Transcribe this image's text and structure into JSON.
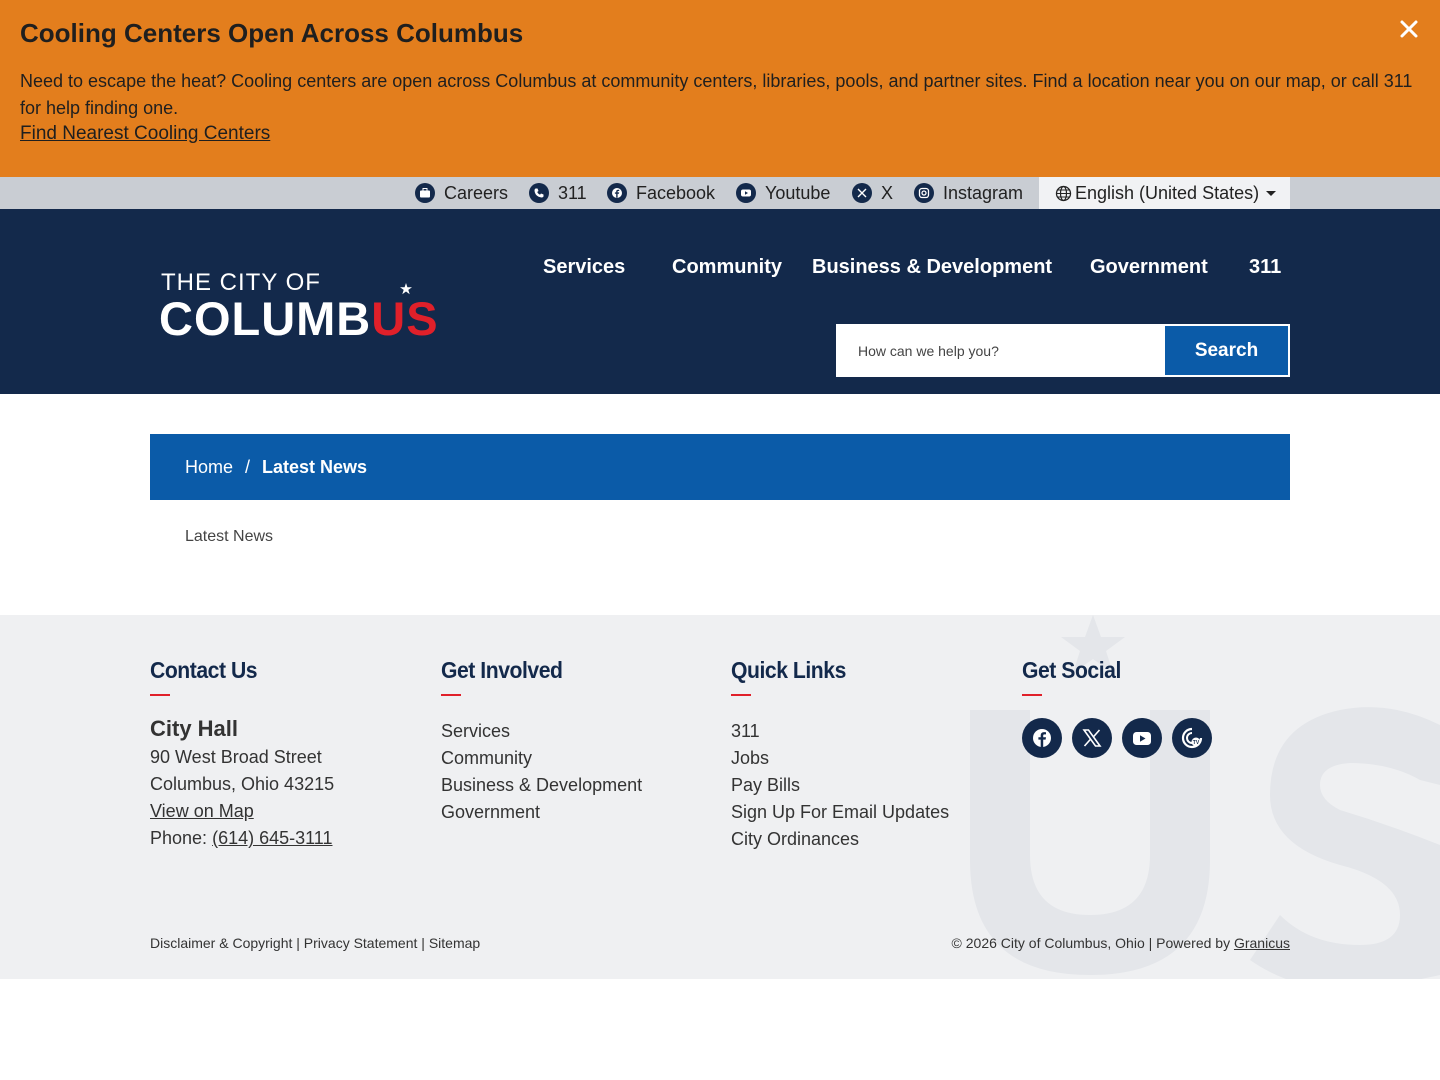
{
  "alert": {
    "title": "Cooling Centers Open Across Columbus",
    "body": "Need to escape the heat? Cooling centers are open across Columbus at community centers, libraries, pools, and partner sites. Find a location near you on our map, or call 311 for help finding one.",
    "link": "Find Nearest Cooling Centers",
    "close_icon": "close-icon"
  },
  "utility": {
    "items": [
      {
        "label": "Careers",
        "icon": "briefcase-icon"
      },
      {
        "label": "311",
        "icon": "phone-icon"
      },
      {
        "label": "Facebook",
        "icon": "facebook-icon"
      },
      {
        "label": "Youtube",
        "icon": "youtube-icon"
      },
      {
        "label": "X",
        "icon": "x-icon"
      },
      {
        "label": "Instagram",
        "icon": "instagram-icon"
      }
    ],
    "language": "English (United States)"
  },
  "header": {
    "logo_top": "THE CITY OF",
    "logo_main": "COLUMB",
    "logo_accent": "US",
    "nav": [
      "Services",
      "Community",
      "Business & Development",
      "Government",
      "311"
    ],
    "search_placeholder": "How can we help you?",
    "search_button": "Search"
  },
  "breadcrumb": {
    "home": "Home",
    "separator": "/",
    "current": "Latest News"
  },
  "main": {
    "heading": "Latest News"
  },
  "footer": {
    "contact": {
      "title": "Contact Us",
      "name": "City Hall",
      "street": "90 West Broad Street",
      "city": "Columbus, Ohio 43215",
      "map_link": "View on Map",
      "phone_label": "Phone:",
      "phone": "(614) 645-3111"
    },
    "get_involved": {
      "title": "Get Involved",
      "links": [
        "Services",
        "Community",
        "Business & Development",
        "Government"
      ]
    },
    "quick_links": {
      "title": "Quick Links",
      "links": [
        "311",
        "Jobs",
        "Pay Bills",
        "Sign Up For Email Updates",
        "City Ordinances"
      ]
    },
    "social": {
      "title": "Get Social",
      "icons": [
        "facebook-icon",
        "x-icon",
        "youtube-icon",
        "cbus-tv-icon"
      ]
    },
    "bottom_left": {
      "disclaimer": "Disclaimer & Copyright",
      "privacy": "Privacy Statement",
      "sitemap": "Sitemap",
      "sep": " | "
    },
    "bottom_right": {
      "copyright": "© 2026 City of Columbus, Ohio | Powered by ",
      "powered": "Granicus"
    }
  },
  "colors": {
    "alert_bg": "#e37e1d",
    "navy": "#13294b",
    "blue": "#0b5ba8",
    "red": "#e0202a",
    "footer_bg": "#eff0f2",
    "utility_bg": "#c9cdd3"
  }
}
